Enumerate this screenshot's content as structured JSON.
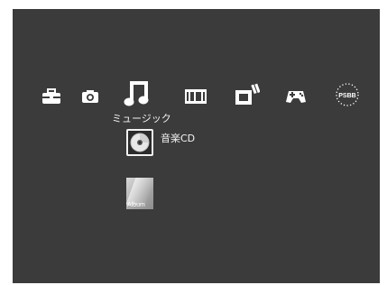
{
  "menu": {
    "categories": [
      {
        "id": "settings",
        "icon": "toolbox-icon",
        "selected": false
      },
      {
        "id": "photo",
        "icon": "camera-icon",
        "selected": false
      },
      {
        "id": "music",
        "icon": "music-note-icon",
        "selected": true
      },
      {
        "id": "video",
        "icon": "film-strip-icon",
        "selected": false
      },
      {
        "id": "network",
        "icon": "network-icon",
        "selected": false
      },
      {
        "id": "game",
        "icon": "gamepad-icon",
        "selected": false
      },
      {
        "id": "psbb",
        "icon": "psbb-icon",
        "label": "PSBB",
        "selected": false
      }
    ],
    "selected_label": "ミュージック"
  },
  "items": [
    {
      "icon": "music-cd-icon",
      "label": "音楽CD",
      "selected": true
    },
    {
      "icon": "album-thumbnail-icon",
      "thumbnail_text": "Album"
    }
  ],
  "colors": {
    "background": "#3b3b3b",
    "icon": "#ffffff",
    "text": "#f0f0f0"
  }
}
